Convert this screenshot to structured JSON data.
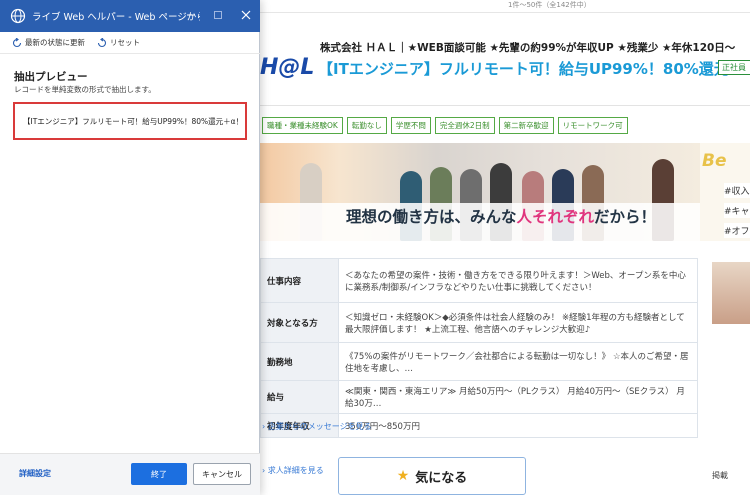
{
  "dialog": {
    "title": "ライブ Web ヘルパー - Web ページからデータを...",
    "toolbar": {
      "refresh_label": "最新の状態に更新",
      "reset_label": "リセット"
    },
    "section_title": "抽出プレビュー",
    "section_desc": "レコードを単純変数の形式で抽出します。",
    "preview_value": "【ITエンジニア】フルリモート可！給与UP99%！80%還元＋α！",
    "advanced_link": "詳細設定",
    "done_label": "終了",
    "cancel_label": "キャンセル",
    "accent_color": "#2b5fb0",
    "highlight_color": "#d93a3a"
  },
  "page": {
    "result_count": "1件～50件（全142件中）",
    "company_line": "株式会社 ＨＡＬ｜★WEB面談可能 ★先輩の約99%が年収UP ★残業少 ★年休120日～",
    "logo": "H@L",
    "job_title": "【ITエンジニア】フルリモート可！給与UP99%！80%還元＋α！",
    "badge": "正社員",
    "tags": [
      "職種・業種未経験OK",
      "転勤なし",
      "学歴不問",
      "完全週休2日制",
      "第二新卒歓迎",
      "リモートワーク可"
    ],
    "banner_slogan_pre": "理想の働き方は、みんな",
    "banner_slogan_hl": "人それぞれ",
    "banner_slogan_post": "だから！",
    "side_word": "Be",
    "side_items": [
      "#収入",
      "#キャ",
      "#オフ"
    ],
    "details": [
      {
        "label": "仕事内容",
        "value": "＜あなたの希望の案件・技術・働き方をできる限り叶えます！＞Web、オープン系を中心に業務系/制御系/インフラなどやりたい仕事に挑戦してください！"
      },
      {
        "label": "対象となる方",
        "value": "＜知識ゼロ・未経験OK＞◆必須条件は社会人経験のみ！ ※経験1年程の方も経験者として最大限評価します！ ★上流工程、他言語へのチャレンジ大歓迎♪"
      },
      {
        "label": "勤務地",
        "value": "《75%の案件がリモートワーク／会社都合による転勤は一切なし！》 ☆本人のご希望・居住地を考慮し、…"
      },
      {
        "label": "給与",
        "value": "≪関東・関西・東海エリア≫ 月給50万円～（PLクラス） 月給40万円～（SEクラス） 月給30万…"
      },
      {
        "label": "初年度年収",
        "value": "350万円～850万円"
      }
    ],
    "company_message_link": "企業からのメッセージを見る",
    "detail_link": "求人詳細を見る",
    "favorite_label": "気になる",
    "right_bottom_text": "掲載"
  }
}
